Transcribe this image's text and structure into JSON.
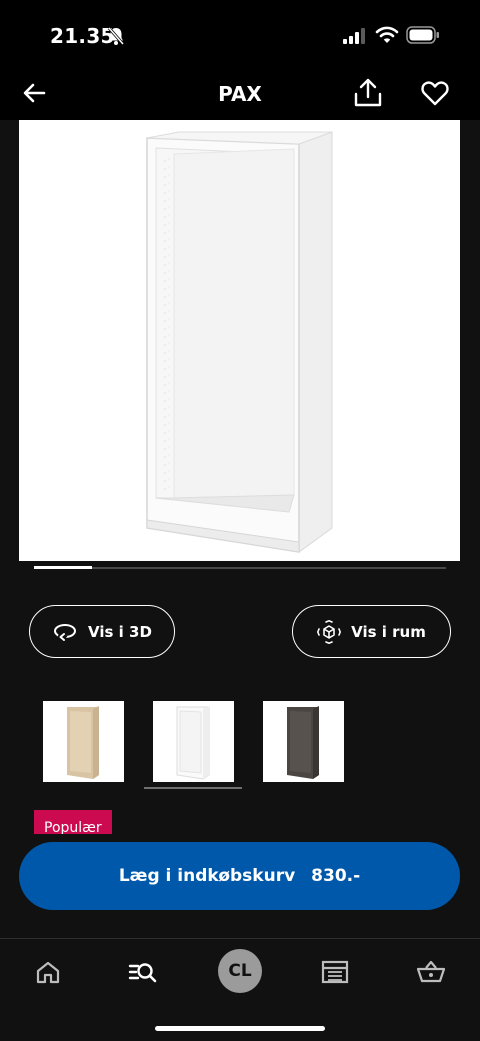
{
  "status_bar": {
    "time": "21.35",
    "icons": [
      "bell-slash-icon",
      "signal-icon",
      "wifi-icon",
      "battery-icon"
    ]
  },
  "header": {
    "title": "PAX",
    "back_icon": "arrow-left-icon",
    "share_icon": "share-icon",
    "favorite_icon": "heart-icon"
  },
  "gallery": {
    "image": "white wardrobe frame",
    "carousel_progress": 0.14
  },
  "actions": {
    "view_3d_label": "Vis i 3D",
    "view_3d_icon": "rotate-icon",
    "view_room_label": "Vis i rum",
    "view_room_icon": "ar-cube-icon"
  },
  "color_variants": [
    {
      "name": "white-stained-oak",
      "color": "#d8c3a2",
      "selected": false
    },
    {
      "name": "white",
      "color": "#f2f2f2",
      "selected": true
    },
    {
      "name": "black-brown",
      "color": "#4b4642",
      "selected": false
    }
  ],
  "badge": {
    "label": "Populær"
  },
  "add_to_cart": {
    "label": "Læg i indkøbskurv",
    "price": "830.-"
  },
  "bottom_nav": {
    "items": [
      "home-icon",
      "search-list-icon",
      "account-avatar",
      "store-icon",
      "basket-icon"
    ],
    "avatar_initials": "CL"
  },
  "colors": {
    "background": "#111111",
    "accent_blue": "#0058ab",
    "badge_pink": "#cc0a4f"
  }
}
